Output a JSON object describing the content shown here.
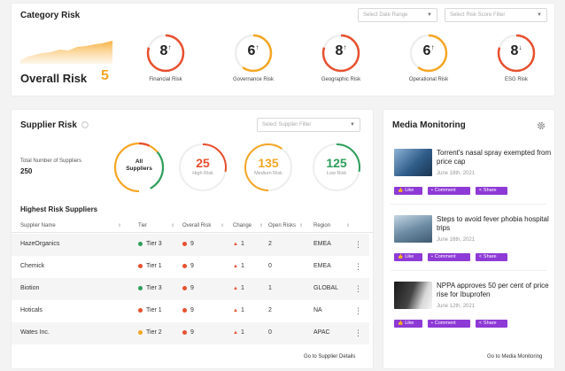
{
  "category_risk": {
    "title": "Category Risk",
    "date_select": "Select Date Range",
    "score_select": "Select Risk Score Filter",
    "overall_label": "Overall Risk",
    "overall_value": "5",
    "gauges": [
      {
        "value": "8",
        "trend": "↑",
        "label": "Financial Risk",
        "color": "#e8502f",
        "fill": 0.8
      },
      {
        "value": "6",
        "trend": "↑",
        "label": "Governance Risk",
        "color": "#f5a623",
        "fill": 0.6
      },
      {
        "value": "8",
        "trend": "↑",
        "label": "Geographic Risk",
        "color": "#e8502f",
        "fill": 0.8
      },
      {
        "value": "6",
        "trend": "↑",
        "label": "Operational Risk",
        "color": "#f5a623",
        "fill": 0.6
      },
      {
        "value": "8",
        "trend": "↓",
        "label": "ESG Risk",
        "color": "#e8502f",
        "fill": 0.8
      }
    ]
  },
  "supplier_risk": {
    "title": "Supplier Risk",
    "info_icon": "info-icon",
    "filter_select": "Select Supplier Filter",
    "total_label": "Total Number of Suppliers",
    "total_value": "250",
    "all_label": "All Suppliers",
    "stats": [
      {
        "value": "25",
        "label": "High Risk",
        "color": "#e8502f"
      },
      {
        "value": "135",
        "label": "Medium Risk",
        "color": "#f5a623"
      },
      {
        "value": "125",
        "label": "Low Risk",
        "color": "#2e9e5b"
      }
    ],
    "table_title": "Highest Risk Suppliers",
    "columns": [
      "Supplier Name",
      "Tier",
      "Overall Risk",
      "Change",
      "Open Risks",
      "Region"
    ],
    "rows": [
      {
        "name": "HazeOrganics",
        "tier": "Tier 3",
        "tier_color": "#2e9e5b",
        "risk": "9",
        "change": "1",
        "open": "2",
        "region": "EMEA"
      },
      {
        "name": "Chemick",
        "tier": "Tier 1",
        "tier_color": "#e8502f",
        "risk": "9",
        "change": "1",
        "open": "0",
        "region": "EMEA"
      },
      {
        "name": "Biotion",
        "tier": "Tier 3",
        "tier_color": "#2e9e5b",
        "risk": "9",
        "change": "1",
        "open": "1",
        "region": "GLOBAL"
      },
      {
        "name": "Hoticals",
        "tier": "Tier 1",
        "tier_color": "#e8502f",
        "risk": "9",
        "change": "1",
        "open": "2",
        "region": "NA"
      },
      {
        "name": "Wates Inc.",
        "tier": "Tier 2",
        "tier_color": "#f5a623",
        "risk": "9",
        "change": "1",
        "open": "0",
        "region": "APAC"
      }
    ],
    "details_link": "Go to Supplier Details"
  },
  "media": {
    "title": "Media Monitoring",
    "settings_icon": "gear-icon",
    "like": "Like",
    "comment": "Comment",
    "share": "Share",
    "news": [
      {
        "title": "Torrent's nasal spray exempted from price cap",
        "date": "June 18th, 2021"
      },
      {
        "title": "Steps to avoid fever phobia hospital trips",
        "date": "June 16th, 2021"
      },
      {
        "title": "NPPA approves 50 per cent of price rise for Ibuprofen",
        "date": "June 12th, 2021"
      }
    ],
    "link": "Go to Media Monitoring"
  },
  "colors": {
    "high": "#e8502f",
    "medium": "#f5a623",
    "low": "#2e9e5b",
    "accent": "#8e3ad6"
  }
}
